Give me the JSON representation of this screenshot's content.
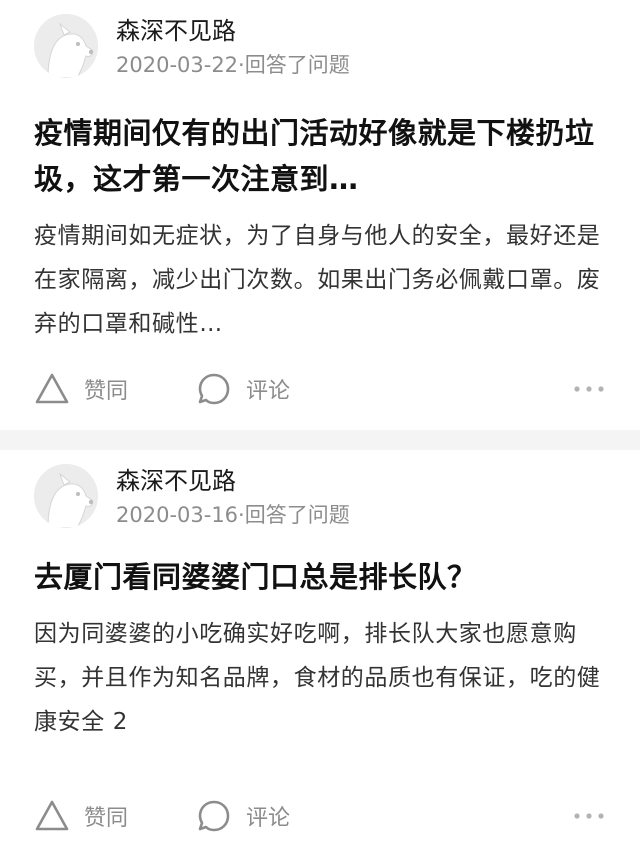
{
  "answers": [
    {
      "author": "森深不见路",
      "meta": "2020-03-22·回答了问题",
      "title": "疫情期间仅有的出门活动好像就是下楼扔垃圾，这才第一次注意到…",
      "excerpt": "疫情期间如无症状，为了自身与他人的安全，最好还是在家隔离，减少出门次数。如果出门务必佩戴口罩。废弃的口罩和碱性…",
      "like_label": "赞同",
      "comment_label": "评论"
    },
    {
      "author": "森深不见路",
      "meta": "2020-03-16·回答了问题",
      "title": "去厦门看同婆婆门口总是排长队？",
      "excerpt": "因为同婆婆的小吃确实好吃啊，排长队大家也愿意购买，并且作为知名品牌，食材的品质也有保证，吃的健康安全 2",
      "like_label": "赞同",
      "comment_label": "评论"
    }
  ],
  "icons": {
    "like": "triangle-outline-icon",
    "comment": "speech-bubble-icon",
    "more": "more-dots-icon",
    "avatar": "dog-avatar"
  },
  "colors": {
    "meta_text": "#8c8c8c",
    "divider": "#f4f4f5",
    "title_text": "#111111"
  }
}
